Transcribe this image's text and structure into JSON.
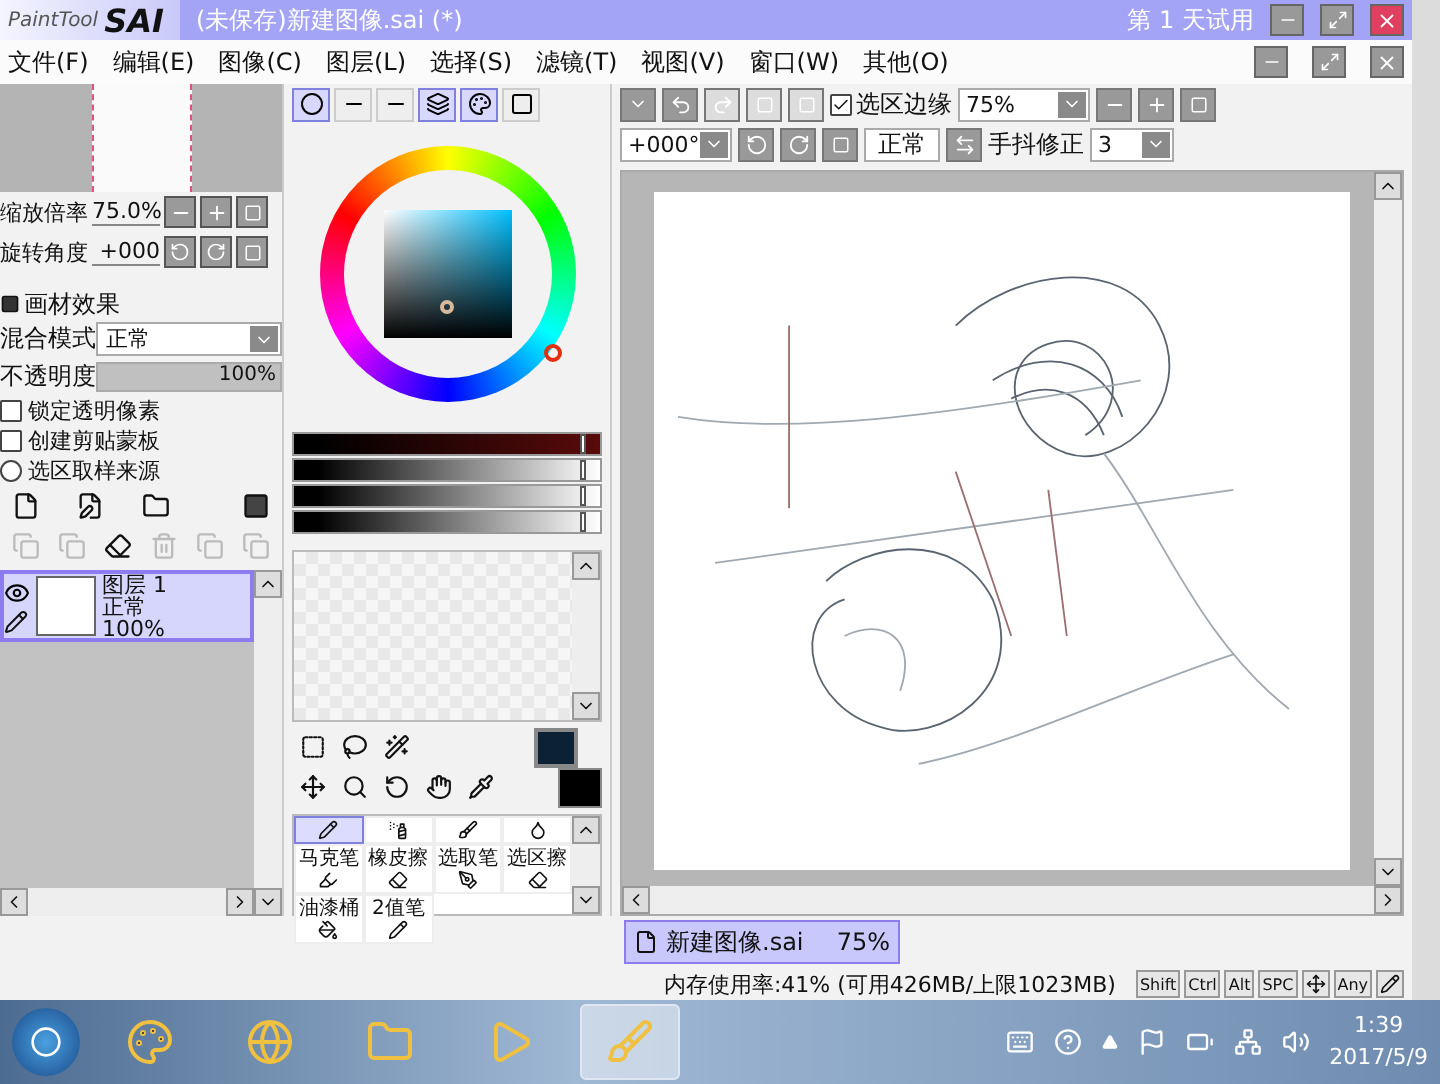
{
  "window": {
    "logo": "PaintTool",
    "brand": "SAI",
    "title": "(未保存)新建图像.sai (*)",
    "trial": "第 1 天试用"
  },
  "menu": [
    {
      "label": "文件(F)"
    },
    {
      "label": "编辑(E)"
    },
    {
      "label": "图像(C)"
    },
    {
      "label": "图层(L)"
    },
    {
      "label": "选择(S)"
    },
    {
      "label": "滤镜(T)"
    },
    {
      "label": "视图(V)"
    },
    {
      "label": "窗口(W)"
    },
    {
      "label": "其他(O)"
    }
  ],
  "navigator": {
    "zoom_label": "缩放倍率",
    "zoom_value": "75.0%",
    "rotate_label": "旋转角度",
    "rotate_value": "+000"
  },
  "layer_props": {
    "section": "画材效果",
    "blend_label": "混合模式",
    "blend_value": "正常",
    "opacity_label": "不透明度",
    "opacity_value": "100%",
    "level": 1,
    "options": [
      {
        "kind": "checkbox",
        "label": "锁定透明像素",
        "checked": false
      },
      {
        "kind": "checkbox",
        "label": "创建剪贴蒙板",
        "checked": false
      },
      {
        "kind": "radio",
        "label": "选区取样来源",
        "checked": false
      }
    ]
  },
  "layers": [
    {
      "name": "图层 1",
      "mode": "正常",
      "opacity": "100%",
      "selected": true,
      "visible": true
    }
  ],
  "color_modes": [
    {
      "kind": "wheel",
      "selected": true
    },
    {
      "kind": "rgb",
      "selected": false
    },
    {
      "kind": "hsv",
      "selected": false
    },
    {
      "kind": "bars",
      "selected": true
    },
    {
      "kind": "swatches",
      "selected": true
    },
    {
      "kind": "scratch",
      "selected": false
    }
  ],
  "sliders": [
    {
      "kind": "red",
      "level": 0.95
    },
    {
      "kind": "gray",
      "level": 0.95
    },
    {
      "kind": "gray",
      "level": 0.95
    },
    {
      "kind": "gray",
      "level": 0.95
    }
  ],
  "foreground": {
    "color": "#0c2036"
  },
  "background": {
    "color": "#000000"
  },
  "tools": [
    {
      "kind": "pencil",
      "selected": true
    },
    {
      "kind": "airbrush",
      "selected": false
    },
    {
      "kind": "brush",
      "selected": false
    },
    {
      "kind": "watercolor",
      "selected": false
    },
    {
      "kind": "marker",
      "label": "马克笔",
      "selected": false
    },
    {
      "kind": "eraser",
      "label": "橡皮擦",
      "selected": false
    },
    {
      "kind": "select-pen",
      "label": "选取笔",
      "selected": false
    },
    {
      "kind": "select-eraser",
      "label": "选区擦",
      "selected": false
    },
    {
      "kind": "bucket",
      "label": "油漆桶",
      "selected": false
    },
    {
      "kind": "binary",
      "label": "2值笔",
      "selected": false
    }
  ],
  "canvas_toolbar": {
    "selection_edge": {
      "label": "选区边缘",
      "checked": true
    },
    "zoom": "75%",
    "rotation": "+000°",
    "mode": "正常",
    "stabilizer_label": "手抖修正",
    "stabilizer": "3"
  },
  "document_tabs": [
    {
      "name": "新建图像.sai",
      "zoom": "75%",
      "selected": true
    }
  ],
  "status": {
    "memory": "内存使用率:41% (可用426MB/上限1023MB)",
    "keys": [
      {
        "kind": "text",
        "label": "Shift"
      },
      {
        "kind": "text",
        "label": "Ctrl"
      },
      {
        "kind": "text",
        "label": "Alt"
      },
      {
        "kind": "text",
        "label": "SPC"
      },
      {
        "kind": "move"
      },
      {
        "kind": "text",
        "label": "Any"
      },
      {
        "kind": "pen"
      }
    ]
  },
  "taskbar": {
    "apps": [
      {
        "kind": "pinwheel",
        "selected": false
      },
      {
        "kind": "browser",
        "selected": false
      },
      {
        "kind": "folder",
        "selected": false
      },
      {
        "kind": "media",
        "selected": false
      },
      {
        "kind": "paint",
        "selected": true
      }
    ],
    "time": "1:39",
    "date": "2017/5/9"
  }
}
